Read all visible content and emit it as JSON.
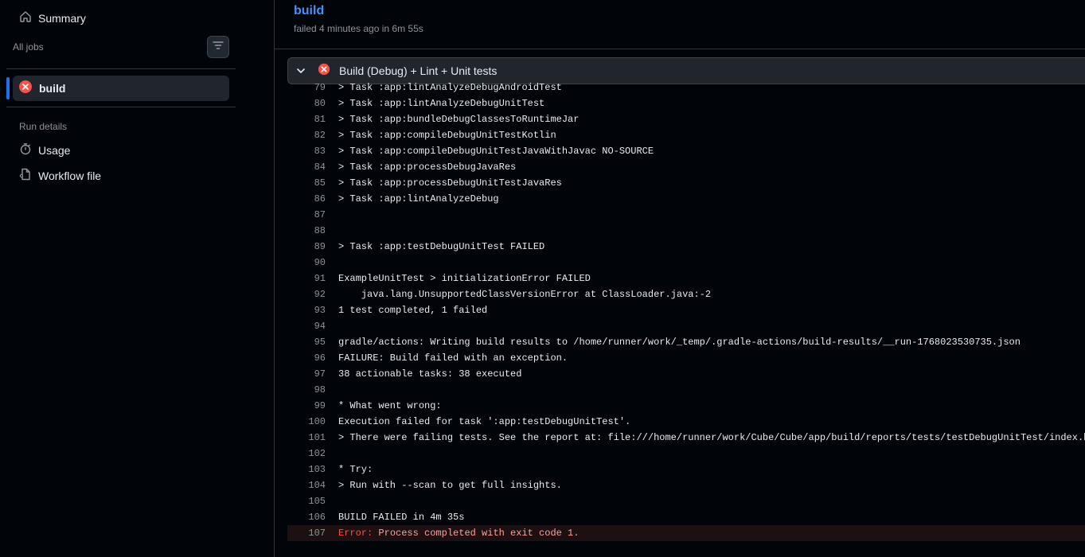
{
  "sidebar": {
    "summary_label": "Summary",
    "all_jobs_label": "All jobs",
    "job_label": "build",
    "run_details_label": "Run details",
    "usage_label": "Usage",
    "workflow_file_label": "Workflow file"
  },
  "header": {
    "title": "build",
    "subtitle": "failed 4 minutes ago in 6m 55s"
  },
  "step": {
    "title": "Build (Debug) + Lint + Unit tests",
    "status": "failed"
  },
  "log_lines": [
    {
      "num": "79",
      "text": "> Task :app:lintAnalyzeDebugAndroidTest"
    },
    {
      "num": "80",
      "text": "> Task :app:lintAnalyzeDebugUnitTest"
    },
    {
      "num": "81",
      "text": "> Task :app:bundleDebugClassesToRuntimeJar"
    },
    {
      "num": "82",
      "text": "> Task :app:compileDebugUnitTestKotlin"
    },
    {
      "num": "83",
      "text": "> Task :app:compileDebugUnitTestJavaWithJavac NO-SOURCE"
    },
    {
      "num": "84",
      "text": "> Task :app:processDebugJavaRes"
    },
    {
      "num": "85",
      "text": "> Task :app:processDebugUnitTestJavaRes"
    },
    {
      "num": "86",
      "text": "> Task :app:lintAnalyzeDebug"
    },
    {
      "num": "87",
      "text": ""
    },
    {
      "num": "88",
      "text": ""
    },
    {
      "num": "89",
      "text": "> Task :app:testDebugUnitTest FAILED"
    },
    {
      "num": "90",
      "text": ""
    },
    {
      "num": "91",
      "text": "ExampleUnitTest > initializationError FAILED"
    },
    {
      "num": "92",
      "text": "    java.lang.UnsupportedClassVersionError at ClassLoader.java:-2"
    },
    {
      "num": "93",
      "text": "1 test completed, 1 failed"
    },
    {
      "num": "94",
      "text": ""
    },
    {
      "num": "95",
      "text": "gradle/actions: Writing build results to /home/runner/work/_temp/.gradle-actions/build-results/__run-1768023530735.json"
    },
    {
      "num": "96",
      "text": "FAILURE: Build failed with an exception."
    },
    {
      "num": "97",
      "text": "38 actionable tasks: 38 executed"
    },
    {
      "num": "98",
      "text": ""
    },
    {
      "num": "99",
      "text": "* What went wrong:"
    },
    {
      "num": "100",
      "text": "Execution failed for task ':app:testDebugUnitTest'."
    },
    {
      "num": "101",
      "text": "> There were failing tests. See the report at: file:///home/runner/work/Cube/Cube/app/build/reports/tests/testDebugUnitTest/index.html"
    },
    {
      "num": "102",
      "text": ""
    },
    {
      "num": "103",
      "text": "* Try:"
    },
    {
      "num": "104",
      "text": "> Run with --scan to get full insights."
    },
    {
      "num": "105",
      "text": ""
    },
    {
      "num": "106",
      "text": "BUILD FAILED in 4m 35s"
    }
  ],
  "error_line": {
    "num": "107",
    "label": "Error:",
    "text": " Process completed with exit code 1."
  },
  "colors": {
    "accent": "#4493f8",
    "error": "#f85149",
    "active_indicator": "#1f6feb"
  },
  "icons": [
    "home-icon",
    "filter-icon",
    "x-circle-icon",
    "stopwatch-icon",
    "workflow-file-icon",
    "chevron-down-icon"
  ]
}
